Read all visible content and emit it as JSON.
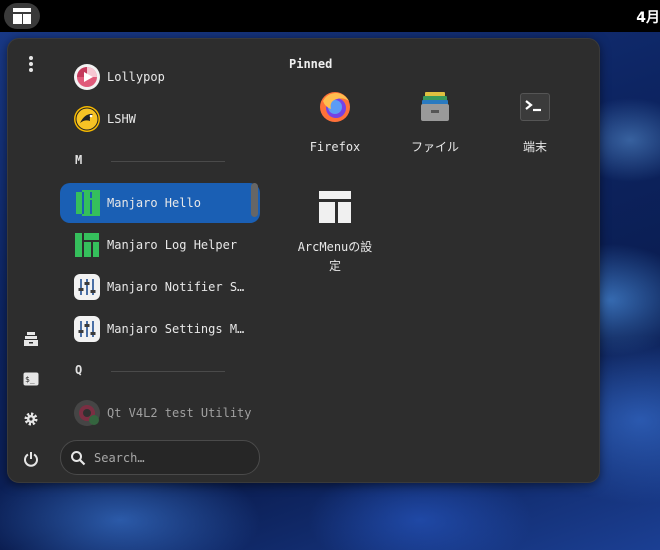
{
  "topbar": {
    "clock": "4月"
  },
  "apps": [
    {
      "label": "Lollypop"
    },
    {
      "label": "LSHW"
    },
    {
      "label": "Manjaro Hello"
    },
    {
      "label": "Manjaro Log Helper"
    },
    {
      "label": "Manjaro Notifier S…"
    },
    {
      "label": "Manjaro Settings M…"
    },
    {
      "label": "Qt V4L2 test Utility"
    }
  ],
  "sections": {
    "m": "M",
    "q": "Q"
  },
  "search": {
    "placeholder": "Search…"
  },
  "pinned": {
    "title": "Pinned",
    "items": [
      {
        "label": "Firefox"
      },
      {
        "label": "ファイル"
      },
      {
        "label": "端末"
      },
      {
        "label": "ArcMenuの設定"
      }
    ]
  },
  "colors": {
    "selected": "#1a5fb4",
    "menu_bg": "#2d2d2d",
    "manjaro_green": "#35bf5c"
  }
}
